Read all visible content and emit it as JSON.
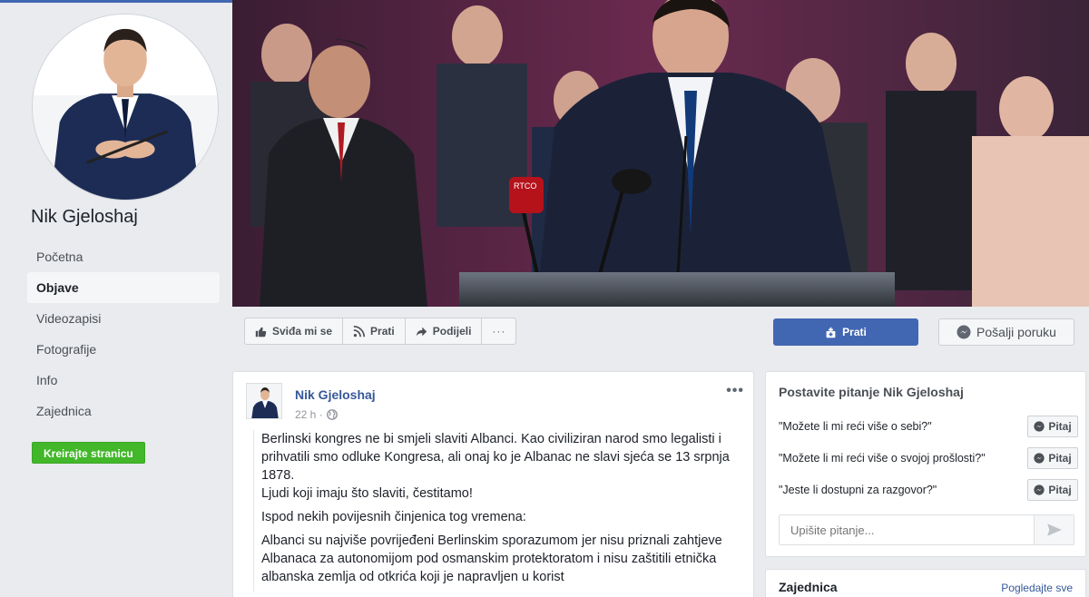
{
  "page": {
    "name": "Nik Gjeloshaj"
  },
  "nav": {
    "items": [
      {
        "label": "Početna"
      },
      {
        "label": "Objave"
      },
      {
        "label": "Videozapisi"
      },
      {
        "label": "Fotografije"
      },
      {
        "label": "Info"
      },
      {
        "label": "Zajednica"
      }
    ],
    "active_index": 1,
    "create_page_label": "Kreirajte stranicu"
  },
  "actions": {
    "like_label": "Sviđa mi se",
    "follow_label": "Prati",
    "share_label": "Podijeli",
    "more_label": "···",
    "primary_follow_label": "Prati",
    "message_label": "Pošalji poruku"
  },
  "post": {
    "author": "Nik Gjeloshaj",
    "time": "22 h ·",
    "paragraphs": [
      "Berlinski kongres ne bi smjeli slaviti Albanci. Kao civiliziran narod smo legalisti i prihvatili smo odluke Kongresa, ali onaj ko je Albanac ne slavi sjeća se 13 srpnja 1878.\nLjudi koji imaju što slaviti, čestitamo!",
      "Ispod nekih povijesnih činjenica tog vremena:",
      "Albanci su najviše povrijeđeni Berlinskim sporazumom jer nisu priznali zahtjeve Albanaca za autonomijom pod osmanskim protektoratom i nisu zaštitili etnička albanska zemlja od otkrića koji je napravljen u korist"
    ],
    "more_label": "•••"
  },
  "ask": {
    "title": "Postavite pitanje Nik Gjeloshaj",
    "questions": [
      {
        "text": "\"Možete li mi reći više o sebi?\"",
        "button": "Pitaj"
      },
      {
        "text": "\"Možete li mi reći više o svojoj prošlosti?\"",
        "button": "Pitaj"
      },
      {
        "text": "\"Jeste li dostupni za razgovor?\"",
        "button": "Pitaj"
      }
    ],
    "input_placeholder": "Upišite pitanje..."
  },
  "community": {
    "title": "Zajednica",
    "link": "Pogledajte sve"
  },
  "colors": {
    "brand": "#4267b2",
    "create_green": "#42b72a",
    "link": "#365899"
  }
}
